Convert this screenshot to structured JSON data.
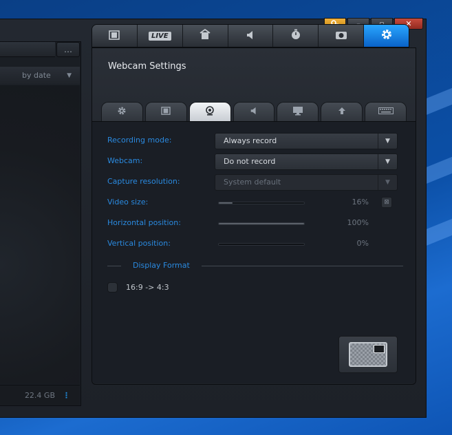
{
  "window": {
    "titlebar": {
      "key_icon": "key-icon",
      "minimize": "–",
      "maximize": "▫",
      "close": "✕"
    }
  },
  "left_panel": {
    "more_label": "…",
    "sort_label": "by date",
    "storage_label": "22.4 GB",
    "menu_label": "⋮"
  },
  "main_tabs": {
    "items": [
      {
        "name": "recordings",
        "icon": "film-icon"
      },
      {
        "name": "live",
        "label": "LIVE"
      },
      {
        "name": "scheduler",
        "icon": "scheduler-icon"
      },
      {
        "name": "audio",
        "icon": "speaker-icon"
      },
      {
        "name": "timer",
        "icon": "stopwatch-icon"
      },
      {
        "name": "screenshot",
        "icon": "camera-icon"
      },
      {
        "name": "settings",
        "icon": "gear-icon",
        "active": true
      }
    ]
  },
  "settings": {
    "title": "Webcam Settings",
    "sub_tabs": [
      {
        "icon": "gear-icon"
      },
      {
        "icon": "film-icon"
      },
      {
        "icon": "webcam-icon",
        "active": true
      },
      {
        "icon": "speaker-icon"
      },
      {
        "icon": "monitor-icon"
      },
      {
        "icon": "upload-icon"
      },
      {
        "icon": "keyboard-icon"
      }
    ],
    "recording_mode": {
      "label": "Recording mode:",
      "value": "Always record"
    },
    "webcam": {
      "label": "Webcam:",
      "value": "Do not record"
    },
    "capture_resolution": {
      "label": "Capture resolution:",
      "value": "System default"
    },
    "video_size": {
      "label": "Video size:",
      "value": "16%",
      "level": 0.16
    },
    "horizontal_position": {
      "label": "Horizontal position:",
      "value": "100%",
      "level": 1.0
    },
    "vertical_position": {
      "label": "Vertical position:",
      "value": "0%",
      "level": 0.0
    },
    "display_format": {
      "label": "Display Format",
      "option": "16:9 -> 4:3"
    }
  },
  "colors": {
    "accent": "#2a8ae0",
    "active_tab": "#1f8ff0",
    "panel_bg": "#1a1e25"
  }
}
